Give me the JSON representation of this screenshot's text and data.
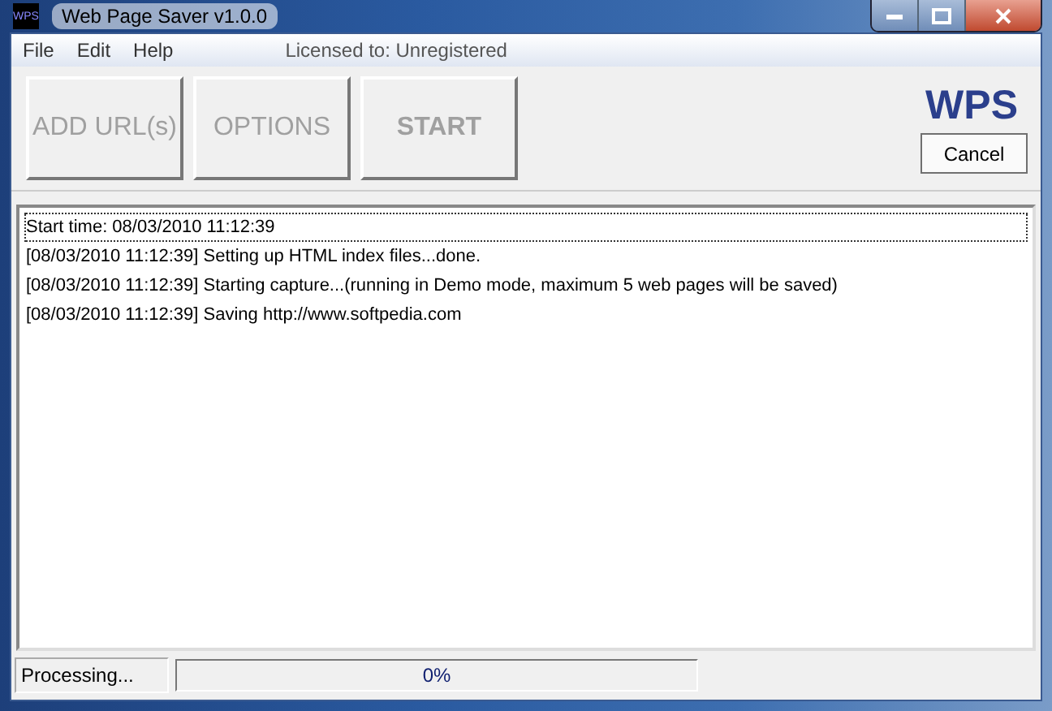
{
  "window": {
    "title": "Web Page Saver v1.0.0",
    "app_icon": "WPS"
  },
  "menu": [
    {
      "label": "File"
    },
    {
      "label": "Edit"
    },
    {
      "label": "Help"
    }
  ],
  "license": "Licensed to: Unregistered",
  "toolbar": [
    {
      "label": "ADD URL(s)",
      "disabled": true
    },
    {
      "label": "OPTIONS",
      "disabled": true
    },
    {
      "label": "START",
      "disabled": true,
      "bold": true
    }
  ],
  "logo": "WPS",
  "cancel_button": "Cancel",
  "log": [
    {
      "text": "Start time: 08/03/2010 11:12:39",
      "selected": true
    },
    {
      "text": "[08/03/2010 11:12:39] Setting up HTML index files...done.",
      "selected": false
    },
    {
      "text": "[08/03/2010 11:12:39] Starting capture...(running in Demo mode, maximum 5 web pages will be saved)",
      "selected": false
    },
    {
      "text": "[08/03/2010 11:12:39] Saving http://www.softpedia.com",
      "selected": false
    }
  ],
  "status_bar": {
    "status": "Processing...",
    "progress": {
      "level": 0,
      "reading": "0%"
    }
  }
}
